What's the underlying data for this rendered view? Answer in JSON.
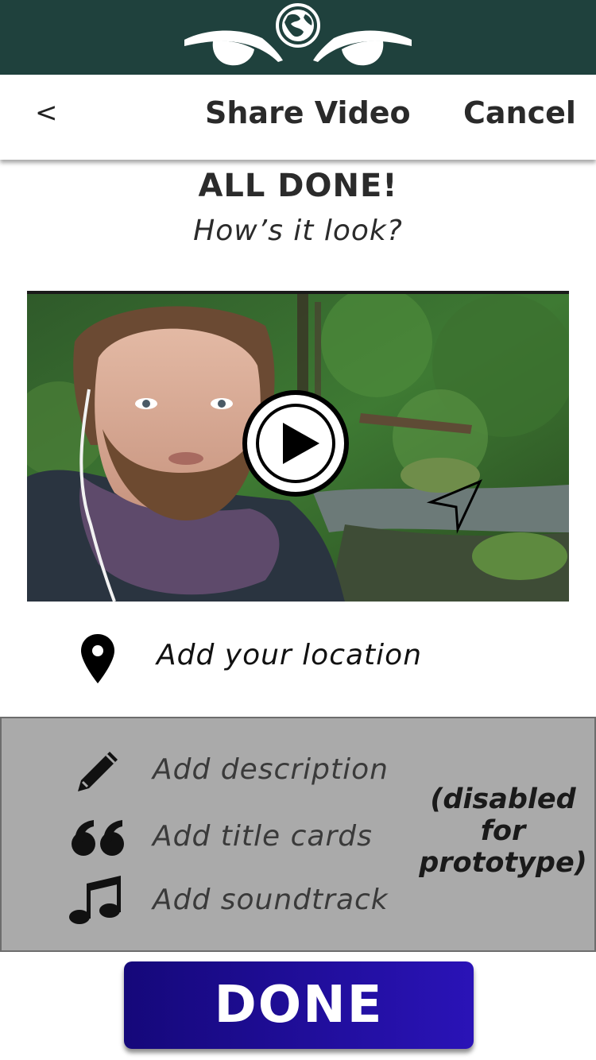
{
  "header": {
    "logo_icon": "globe-eyes-logo-icon",
    "bg_color": "#1f413d"
  },
  "navbar": {
    "back_label": "<",
    "title": "Share Video",
    "cancel_label": "Cancel"
  },
  "main": {
    "heading": "ALL DONE!",
    "subheading": "How’s it look?"
  },
  "video": {
    "play_icon": "play-icon",
    "direction_icon": "navigation-arrow-icon"
  },
  "location": {
    "icon": "map-pin-icon",
    "label": "Add your location"
  },
  "options": {
    "items": [
      {
        "icon": "pencil-icon",
        "label": "Add description"
      },
      {
        "icon": "quote-icon",
        "label": "Add title cards"
      },
      {
        "icon": "music-note-icon",
        "label": "Add soundtrack"
      }
    ],
    "disabled_note_lines": [
      "(disabled",
      "for",
      "prototype)"
    ],
    "panel_color": "#aaaaaa"
  },
  "done_button": {
    "label": "DONE",
    "color": "#1f0e9c"
  }
}
